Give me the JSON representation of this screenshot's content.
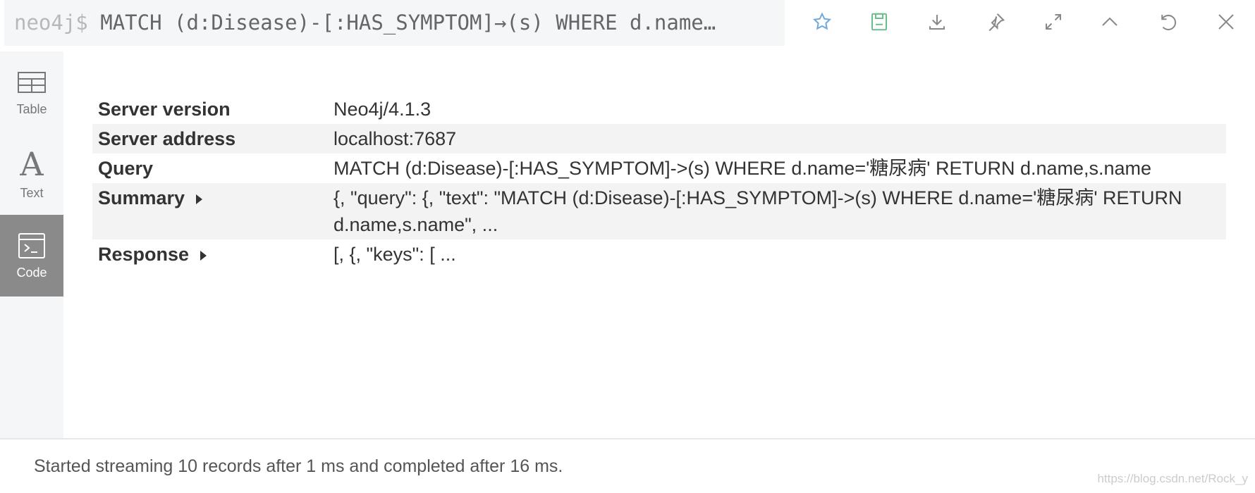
{
  "header": {
    "prompt": "neo4j$",
    "query": "MATCH (d:Disease)-[:HAS_SYMPTOM]→(s) WHERE d.name…",
    "icons": [
      "star-icon",
      "save-icon",
      "download-icon",
      "pin-icon",
      "expand-icon",
      "collapse-icon",
      "rerun-icon",
      "close-icon"
    ],
    "colors": {
      "star": "#6fa8dc",
      "save": "#6abf8a"
    }
  },
  "sidebar": {
    "items": [
      {
        "label": "Table"
      },
      {
        "label": "Text"
      },
      {
        "label": "Code",
        "active": true
      }
    ]
  },
  "rows": [
    {
      "key": "Server version",
      "value": "Neo4j/4.1.3"
    },
    {
      "key": "Server address",
      "value": "localhost:7687"
    },
    {
      "key": "Query",
      "value": "MATCH (d:Disease)-[:HAS_SYMPTOM]->(s) WHERE d.name='糖尿病' RETURN d.name,s.name"
    },
    {
      "key": "Summary",
      "value": "{, \"query\": {, \"text\": \"MATCH (d:Disease)-[:HAS_SYMPTOM]->(s) WHERE d.name='糖尿病' RETURN d.name,s.name\", ..."
    },
    {
      "key": "Response",
      "value": "[, {, \"keys\": [ ..."
    }
  ],
  "footer": {
    "status": "Started streaming 10 records after 1 ms and completed after 16 ms.",
    "watermark": "https://blog.csdn.net/Rock_y"
  }
}
